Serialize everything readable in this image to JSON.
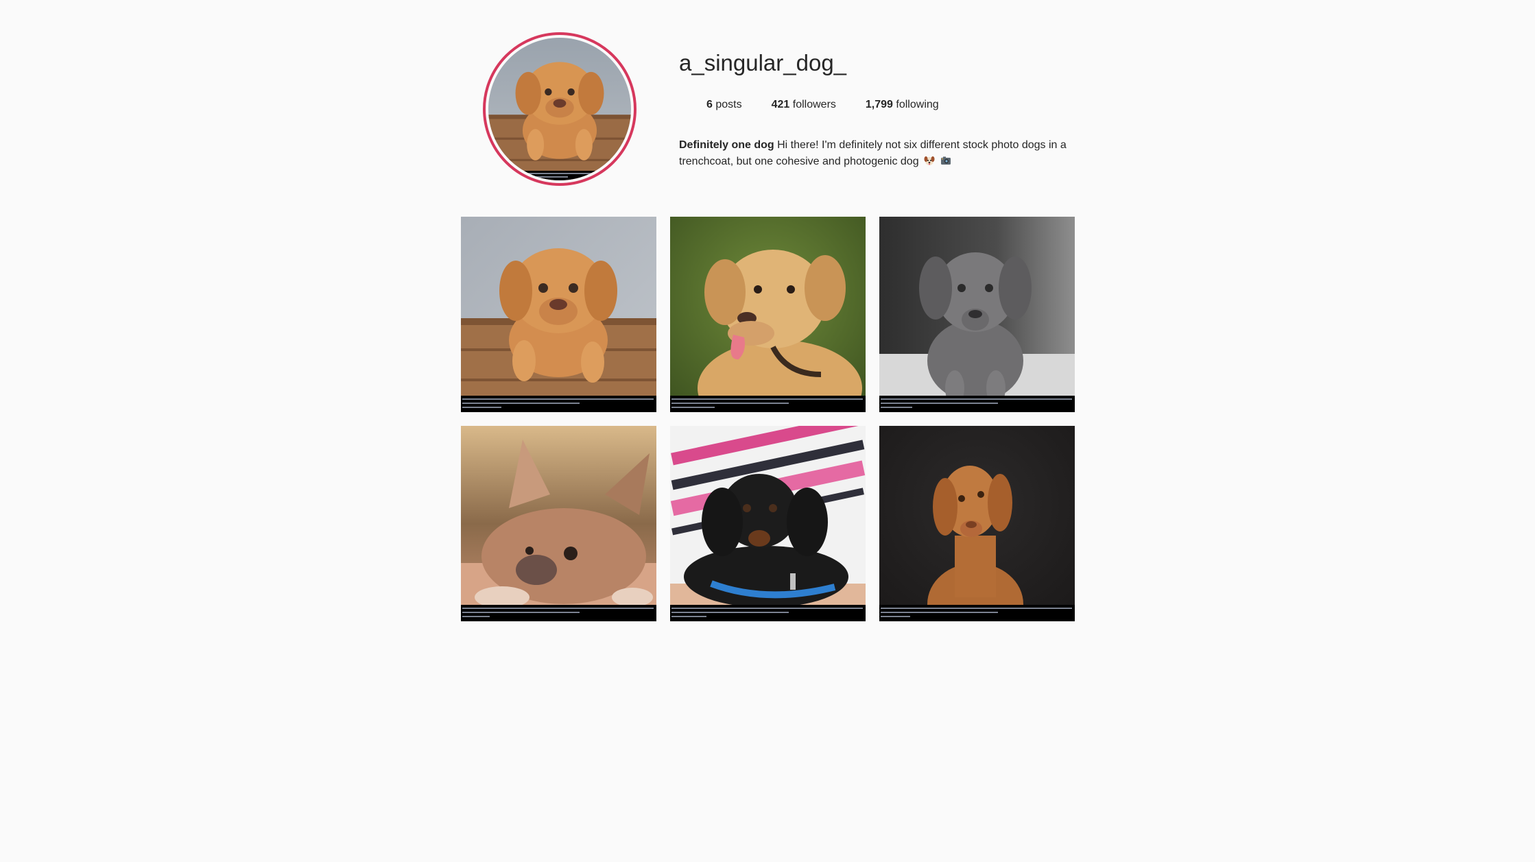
{
  "profile": {
    "username": "a_singular_dog_",
    "stats": {
      "posts_value": "6",
      "posts_label": "posts",
      "followers_value": "421",
      "followers_label": "followers",
      "following_value": "1,799",
      "following_label": "following"
    },
    "bio": {
      "name": "Definitely one dog",
      "text": "Hi there! I'm definitely not six different stock photo dogs in a trenchcoat, but one cohesive and photogenic dog",
      "emojis": [
        "dog-face-emoji",
        "camera-emoji"
      ]
    }
  },
  "colors": {
    "avatar_ring": "#d6385d",
    "background": "#fafafa",
    "text": "#262626"
  },
  "posts": [
    {
      "subject": "bordeaux-puppy-on-fence"
    },
    {
      "subject": "golden-labrador"
    },
    {
      "subject": "grey-weimaraner-puppy"
    },
    {
      "subject": "french-bulldog-lying"
    },
    {
      "subject": "black-dachshund-puppy"
    },
    {
      "subject": "vizsla-portrait"
    }
  ]
}
